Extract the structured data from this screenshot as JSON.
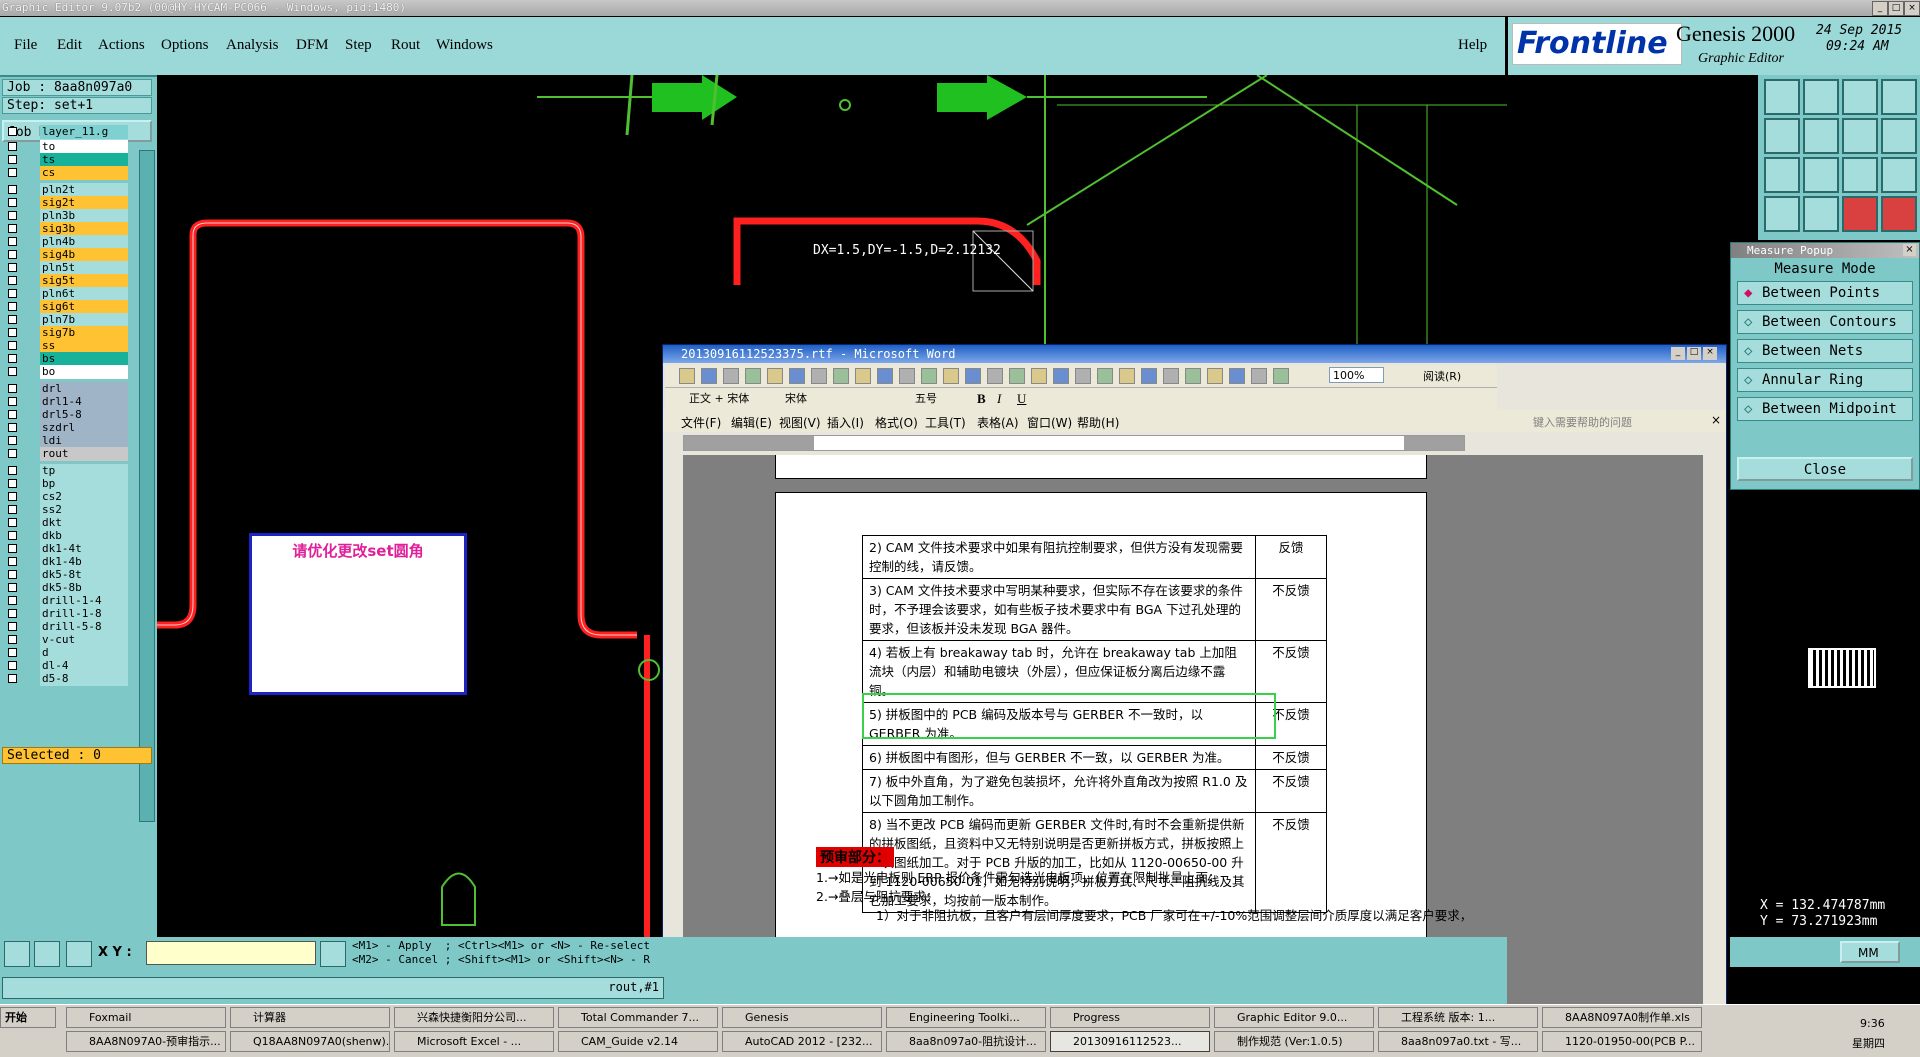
{
  "titlebar": {
    "title": "Graphic Editor 9.07b2 (00@HY-HYCAM-PC066 - Windows, pid:1480)"
  },
  "menu": {
    "items": [
      "File",
      "Edit",
      "Actions",
      "Options",
      "Analysis",
      "DFM",
      "Step",
      "Rout",
      "Windows"
    ],
    "help": "Help"
  },
  "brand": {
    "logo": "Frontline",
    "product": "Genesis 2000",
    "subtitle": "Graphic Editor",
    "date": "24 Sep 2015",
    "time": "09:24 AM"
  },
  "job": {
    "job": "Job : 8aa8n097a0",
    "step": "Step: set+1",
    "matrix_button": "Job Matrix ..."
  },
  "layers": [
    {
      "name": "layer_11.g",
      "color": "#7fd0d0"
    },
    {
      "name": "to",
      "color": "#ffffff"
    },
    {
      "name": "ts",
      "color": "#18b29a"
    },
    {
      "name": "cs",
      "color": "#ffc233"
    },
    {
      "name": "pln2t",
      "color": "#a5dcdc"
    },
    {
      "name": "sig2t",
      "color": "#ffc233"
    },
    {
      "name": "pln3b",
      "color": "#a5dcdc"
    },
    {
      "name": "sig3b",
      "color": "#ffc233"
    },
    {
      "name": "pln4b",
      "color": "#a5dcdc"
    },
    {
      "name": "sig4b",
      "color": "#ffc233"
    },
    {
      "name": "pln5t",
      "color": "#a5dcdc"
    },
    {
      "name": "sig5t",
      "color": "#ffc233"
    },
    {
      "name": "pln6t",
      "color": "#a5dcdc"
    },
    {
      "name": "sig6t",
      "color": "#ffc233"
    },
    {
      "name": "pln7b",
      "color": "#a5dcdc"
    },
    {
      "name": "sig7b",
      "color": "#ffc233"
    },
    {
      "name": "ss",
      "color": "#ffc233"
    },
    {
      "name": "bs",
      "color": "#18b29a"
    },
    {
      "name": "bo",
      "color": "#ffffff"
    },
    {
      "name": "drl",
      "color": "#a0b4c8"
    },
    {
      "name": "drl1-4",
      "color": "#a0b4c8"
    },
    {
      "name": "drl5-8",
      "color": "#a0b4c8"
    },
    {
      "name": "szdrl",
      "color": "#a0b4c8"
    },
    {
      "name": "ldi",
      "color": "#a0b4c8"
    },
    {
      "name": "rout",
      "color": "#c8c8c8"
    },
    {
      "name": "tp",
      "color": "#a5dcdc"
    },
    {
      "name": "bp",
      "color": "#a5dcdc"
    },
    {
      "name": "cs2",
      "color": "#a5dcdc"
    },
    {
      "name": "ss2",
      "color": "#a5dcdc"
    },
    {
      "name": "dkt",
      "color": "#a5dcdc"
    },
    {
      "name": "dkb",
      "color": "#a5dcdc"
    },
    {
      "name": "dk1-4t",
      "color": "#a5dcdc"
    },
    {
      "name": "dk1-4b",
      "color": "#a5dcdc"
    },
    {
      "name": "dk5-8t",
      "color": "#a5dcdc"
    },
    {
      "name": "dk5-8b",
      "color": "#a5dcdc"
    },
    {
      "name": "drill-1-4",
      "color": "#a5dcdc"
    },
    {
      "name": "drill-1-8",
      "color": "#a5dcdc"
    },
    {
      "name": "drill-5-8",
      "color": "#a5dcdc"
    },
    {
      "name": "v-cut",
      "color": "#a5dcdc"
    },
    {
      "name": "d",
      "color": "#a5dcdc"
    },
    {
      "name": "dl-4",
      "color": "#a5dcdc"
    },
    {
      "name": "d5-8",
      "color": "#a5dcdc"
    }
  ],
  "selected": "Selected : 0",
  "canvas": {
    "measure_text": "DX=1.5,DY=-1.5,D=2.12132",
    "note": "请优化更改set圆角"
  },
  "status": {
    "xy_label": "X Y :",
    "hint1": "<M1> - Apply  ; <Ctrl><M1> or <N> - Re-select",
    "hint2": "<M2> - Cancel ; <Shift><M1> or <Shift><N> - R",
    "bottom_right": "rout,#1",
    "x": "X = 132.474787mm",
    "y": "Y = 73.271923mm",
    "units": "MM"
  },
  "measure": {
    "title": "Measure Popup",
    "mode": "Measure Mode",
    "options": [
      "Between Points",
      "Between Contours",
      "Between Nets",
      "Annular Ring",
      "Between Midpoint"
    ],
    "close": "Close"
  },
  "word": {
    "title": "20130916112523375.rtf - Microsoft Word",
    "style": "正文 + 宋体",
    "font": "宋体",
    "size": "五号",
    "zoom": "100%",
    "read": "阅读(R)",
    "menus": [
      "文件(F)",
      "编辑(E)",
      "视图(V)",
      "插入(I)",
      "格式(O)",
      "工具(T)",
      "表格(A)",
      "窗口(W)",
      "帮助(H)"
    ],
    "help_placeholder": "键入需要帮助的问题",
    "rows": [
      {
        "text": "2) CAM 文件技术要求中如果有阻抗控制要求，但供方没有发现需要控制的线，请反馈。",
        "fb": "反馈"
      },
      {
        "text": "3) CAM 文件技术要求中写明某种要求，但实际不存在该要求的条件时，不予理会该要求，如有些板子技术要求中有 BGA 下过孔处理的要求，但该板并没未发现 BGA 器件。",
        "fb": "不反馈"
      },
      {
        "text": "4) 若板上有 breakaway tab 时，允许在 breakaway tab 上加阻流块（内层）和辅助电镀块（外层），但应保证板分离后边缘不露铜。",
        "fb": "不反馈"
      },
      {
        "text": "5) 拼板图中的 PCB 编码及版本号与 GERBER 不一致时，以 GERBER 为准。",
        "fb": "不反馈"
      },
      {
        "text": "6) 拼板图中有图形，但与 GERBER 不一致，以 GERBER 为准。",
        "fb": "不反馈"
      },
      {
        "text": "7) 板中外直角，为了避免包装损坏，允许将外直角改为按照 R1.0 及以下圆角加工制作。",
        "fb": "不反馈"
      },
      {
        "text": "8) 当不更改 PCB 编码而更新 GERBER 文件时,有时不会重新提供新的拼板图纸，且资料中又无特别说明是否更新拼板方式，拼板按照上一次图纸加工。对于 PCB 升版的加工，比如从 1120-00650-00 升到 1120-00650-01，如无特别说明，拼板方式、尺寸、阻抗线及其它加工要求，均按前一版本制作。",
        "fb": "不反馈"
      }
    ],
    "section_heading": "预审部分：",
    "lines": [
      "1.→如是光电板则 ERP 报价条件需勾选光电板项，位置在限制批量上面；",
      "2.→叠层与阻抗要求：",
      "1）对于非阻抗板，且客户有层间厚度要求，PCB 厂家可在+/-10%范围调整层间介质厚度以满足客户要求，"
    ]
  },
  "taskbar": {
    "start": "开始",
    "row1": [
      "Foxmail",
      "计算器",
      "兴森快捷衡阳分公司...",
      "Total Commander 7...",
      "Genesis",
      "Engineering Toolki...",
      "Progress",
      "Graphic Editor 9.0...",
      "工程系统    版本: 1...",
      "8AA8N097A0制作单.xls"
    ],
    "row2": [
      "8AA8N097A0-预审指示...",
      "Q18AA8N097A0(shenw)...",
      "Microsoft Excel - ...",
      "CAM_Guide v2.14",
      "AutoCAD 2012 - [232...",
      "8aa8n097a0-阻抗设计...",
      "20130916112523...",
      "制作规范 (Ver:1.0.5)",
      "8aa8n097a0.txt - 写...",
      "1120-01950-00(PCB P..."
    ],
    "clock": "9:36",
    "weekday": "星期四"
  },
  "colors": {
    "panel": "#7ec8c8",
    "canvas": "#000000",
    "trace": "#ff2020",
    "outline": "#6fd030",
    "word_title": "#1d5fc6"
  }
}
